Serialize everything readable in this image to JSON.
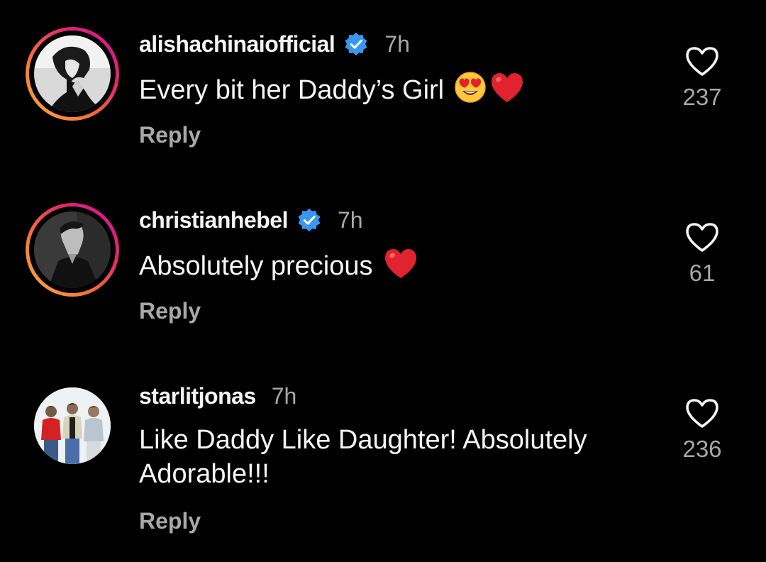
{
  "comments": [
    {
      "username": "alishachinaiofficial",
      "verified": true,
      "time": "7h",
      "text": "Every bit her Daddy’s Girl",
      "emojis": [
        "smiling-face-with-heart-eyes",
        "red-heart"
      ],
      "reply_label": "Reply",
      "likes": "237",
      "has_story_ring": true
    },
    {
      "username": "christianhebel",
      "verified": true,
      "time": "7h",
      "text": "Absolutely precious",
      "emojis": [
        "red-heart"
      ],
      "reply_label": "Reply",
      "likes": "61",
      "has_story_ring": true
    },
    {
      "username": "starlitjonas",
      "verified": false,
      "time": "7h",
      "text": "Like Daddy Like Daughter! Absolutely Adorable!!!",
      "emojis": [],
      "reply_label": "Reply",
      "likes": "236",
      "has_story_ring": false
    }
  ],
  "colors": {
    "background": "#000000",
    "primary_text": "#f5f5f5",
    "secondary_text": "#a8a8a8",
    "verified_badge": "#3897f0",
    "heart_emoji": "#e0232e"
  }
}
